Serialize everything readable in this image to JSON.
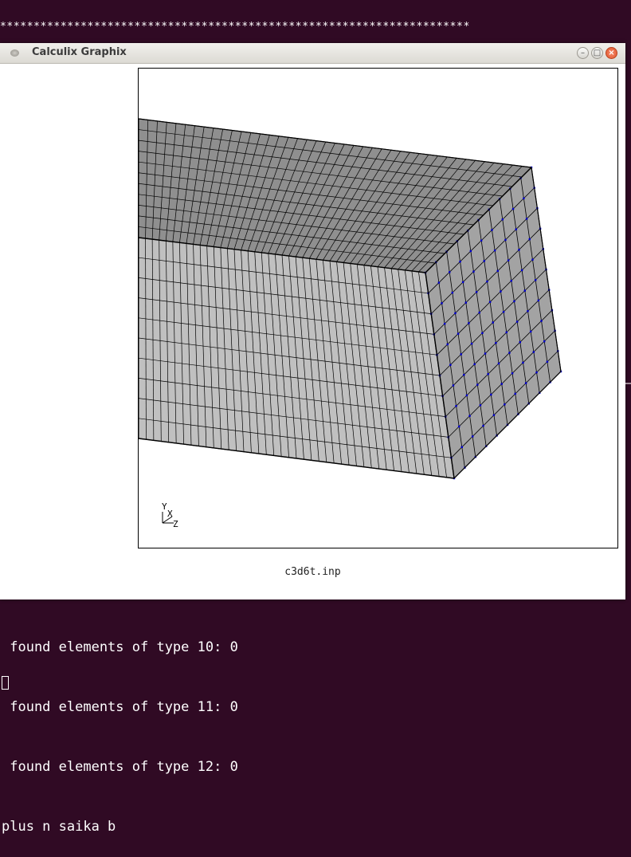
{
  "terminal": {
    "stars": "**********************************************************************",
    "lines": [
      " found elements of type 10: 0",
      " found elements of type 11: 0",
      " found elements of type 12: 0",
      "plus n saika b"
    ]
  },
  "window": {
    "title": "Calculix Graphix",
    "buttons": {
      "minimize": "–",
      "maximize": "□",
      "close": "×"
    },
    "filename": "c3d6t.inp",
    "axis_triad": {
      "labels": [
        "Y",
        "X",
        "Z"
      ]
    }
  },
  "colors": {
    "terminal_bg": "#300a24",
    "top_face": "#8f8f8f",
    "front_face": "#c0c0c0",
    "side_face": "#a3a3a3",
    "node_marker": "#0000cc",
    "mesh_line": "#000000"
  }
}
